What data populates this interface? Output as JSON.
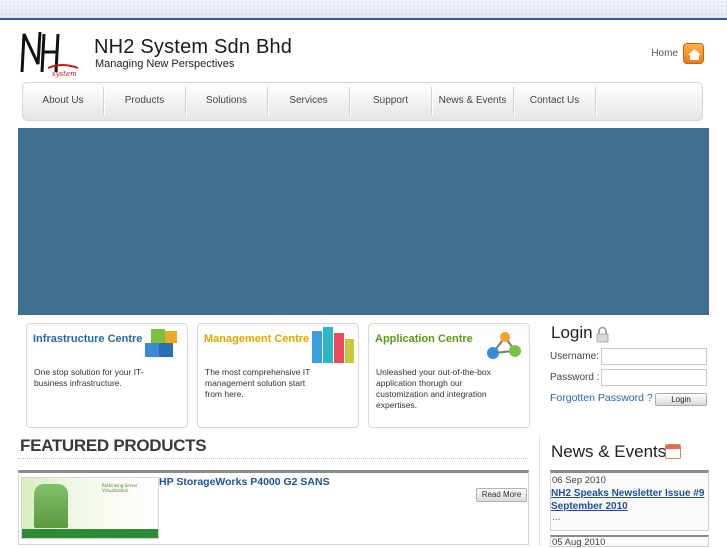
{
  "header": {
    "logo_text": "NH",
    "logo_subtext": "system",
    "title": "NH2 System Sdn Bhd",
    "tagline": "Managing New Perspectives",
    "home_label": "Home"
  },
  "nav": {
    "items": [
      {
        "label": "About Us"
      },
      {
        "label": "Products"
      },
      {
        "label": "Solutions"
      },
      {
        "label": "Services"
      },
      {
        "label": "Support"
      },
      {
        "label": "News & Events"
      },
      {
        "label": "Contact Us"
      }
    ]
  },
  "centres": [
    {
      "title": "Infrastructure Centre",
      "description": "One stop solution for your IT-business infrastructure.",
      "title_color": "#2b6aa8",
      "icon": "cubes-icon"
    },
    {
      "title": "Management Centre",
      "description": "The most comprehensive IT management solution start from here.",
      "title_color": "#e0a800",
      "icon": "bar-blocks-icon"
    },
    {
      "title": "Application Centre",
      "description": "Unleashed your out-of-the-box application thorugh our customization and integration expertises.",
      "title_color": "#5a9a1a",
      "icon": "network-nodes-icon"
    }
  ],
  "login": {
    "title": "Login",
    "username_label": "Username:",
    "password_label": "Password :",
    "forgot_label": "Forgotten Password ?",
    "button_label": "Login"
  },
  "featured": {
    "heading": "FEATURED PRODUCTS",
    "products": [
      {
        "title": "HP StorageWorks P4000 G2 SANS",
        "read_more": "Read More",
        "thumb_text": "Rethinking Server Virtualization"
      }
    ]
  },
  "news": {
    "heading": "News & Events",
    "items": [
      {
        "date": "06 Sep 2010",
        "title": "NH2 Speaks Newsletter Issue #9 September 2010",
        "excerpt": "..."
      },
      {
        "date": "05 Aug 2010"
      }
    ]
  },
  "colors": {
    "accent_blue": "#2f5f9e",
    "banner": "#3f6e8f",
    "link": "#1f4f9a"
  }
}
